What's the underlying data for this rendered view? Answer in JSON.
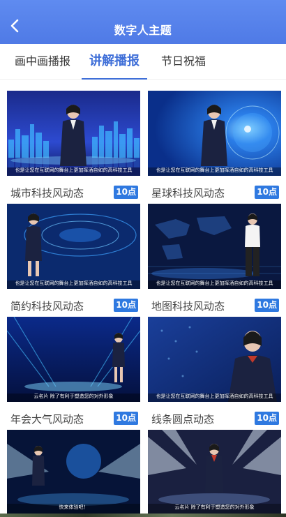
{
  "header": {
    "title": "数字人主题"
  },
  "tabs": [
    {
      "label": "画中画播报"
    },
    {
      "label": "讲解播报"
    },
    {
      "label": "节日祝福"
    }
  ],
  "cards": [
    {
      "name": "城市科技风动态",
      "badge": "10点",
      "caption": "也是让您在互联网的舞台上更加挥洒自如的高科技工具"
    },
    {
      "name": "星球科技风动态",
      "badge": "10点",
      "caption": "也是让您在互联网的舞台上更加挥洒自如的高科技工具"
    },
    {
      "name": "简约科技风动态",
      "badge": "10点",
      "caption": "也是让您在互联网的舞台上更加挥洒自如的高科技工具"
    },
    {
      "name": "地图科技风动态",
      "badge": "10点",
      "caption": "也是让您在互联网的舞台上更加挥洒自如的高科技工具"
    },
    {
      "name": "年会大气风动态",
      "badge": "10点",
      "caption": "云名片 除了有利于塑造您的对外形象"
    },
    {
      "name": "线条圆点动态",
      "badge": "10点",
      "caption": "也是让您在互联网的舞台上更加挥洒自如的高科技工具"
    },
    {
      "name": "",
      "badge": "",
      "caption": "快来体验吧！"
    },
    {
      "name": "",
      "badge": "",
      "caption": "云名片 除了有利于塑造您的对外形象"
    }
  ]
}
